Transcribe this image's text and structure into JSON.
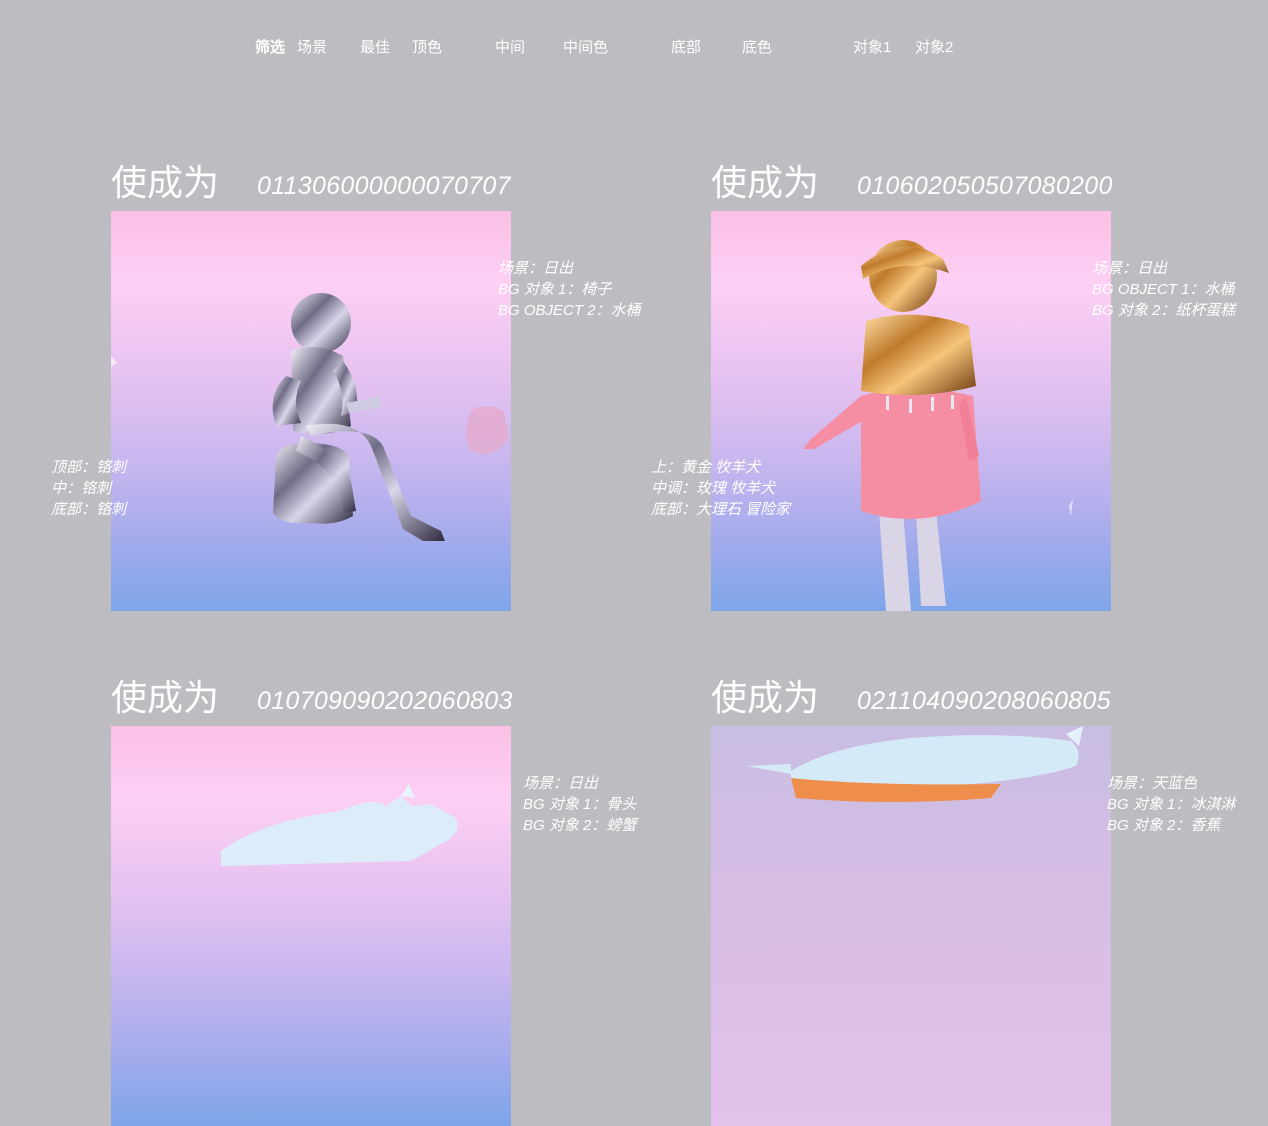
{
  "filter_bar": {
    "label": "筛选",
    "items": [
      "场景",
      "最佳",
      "顶色",
      "中间",
      "中间色",
      "底部",
      "底色",
      "对象1",
      "对象2"
    ]
  },
  "cards": [
    {
      "title": "使成为",
      "code": "011306000000070707",
      "meta_right": [
        "场景：日出",
        "BG 对象 1：椅子",
        "BG OBJECT 2：水桶"
      ],
      "meta_left": [
        "顶部：铬刺",
        "中：铬刺",
        "底部：铬刺"
      ]
    },
    {
      "title": "使成为",
      "code": "010602050507080200",
      "meta_right": [
        "场景：日出",
        "BG OBJECT 1：水桶",
        "BG 对象 2：纸杯蛋糕"
      ],
      "meta_left": [
        "上：黄金 牧羊犬",
        "中调：玫瑰 牧羊犬",
        "底部：大理石 冒险家"
      ]
    },
    {
      "title": "使成为",
      "code": "010709090202060803",
      "meta_right": [
        "场景：日出",
        "BG 对象 1：骨头",
        "BG 对象 2：螃蟹"
      ],
      "meta_left": []
    },
    {
      "title": "使成为",
      "code": "021104090208060805",
      "meta_right": [
        "场景：天蓝色",
        "BG 对象 1：冰淇淋",
        "BG 对象 2：香蕉"
      ],
      "meta_left": []
    }
  ],
  "colors": {
    "page_bg": "#bdbcc0",
    "text": "#ffffff",
    "gradient_top": "#fbc0e6",
    "gradient_bottom": "#7ea5e9"
  }
}
